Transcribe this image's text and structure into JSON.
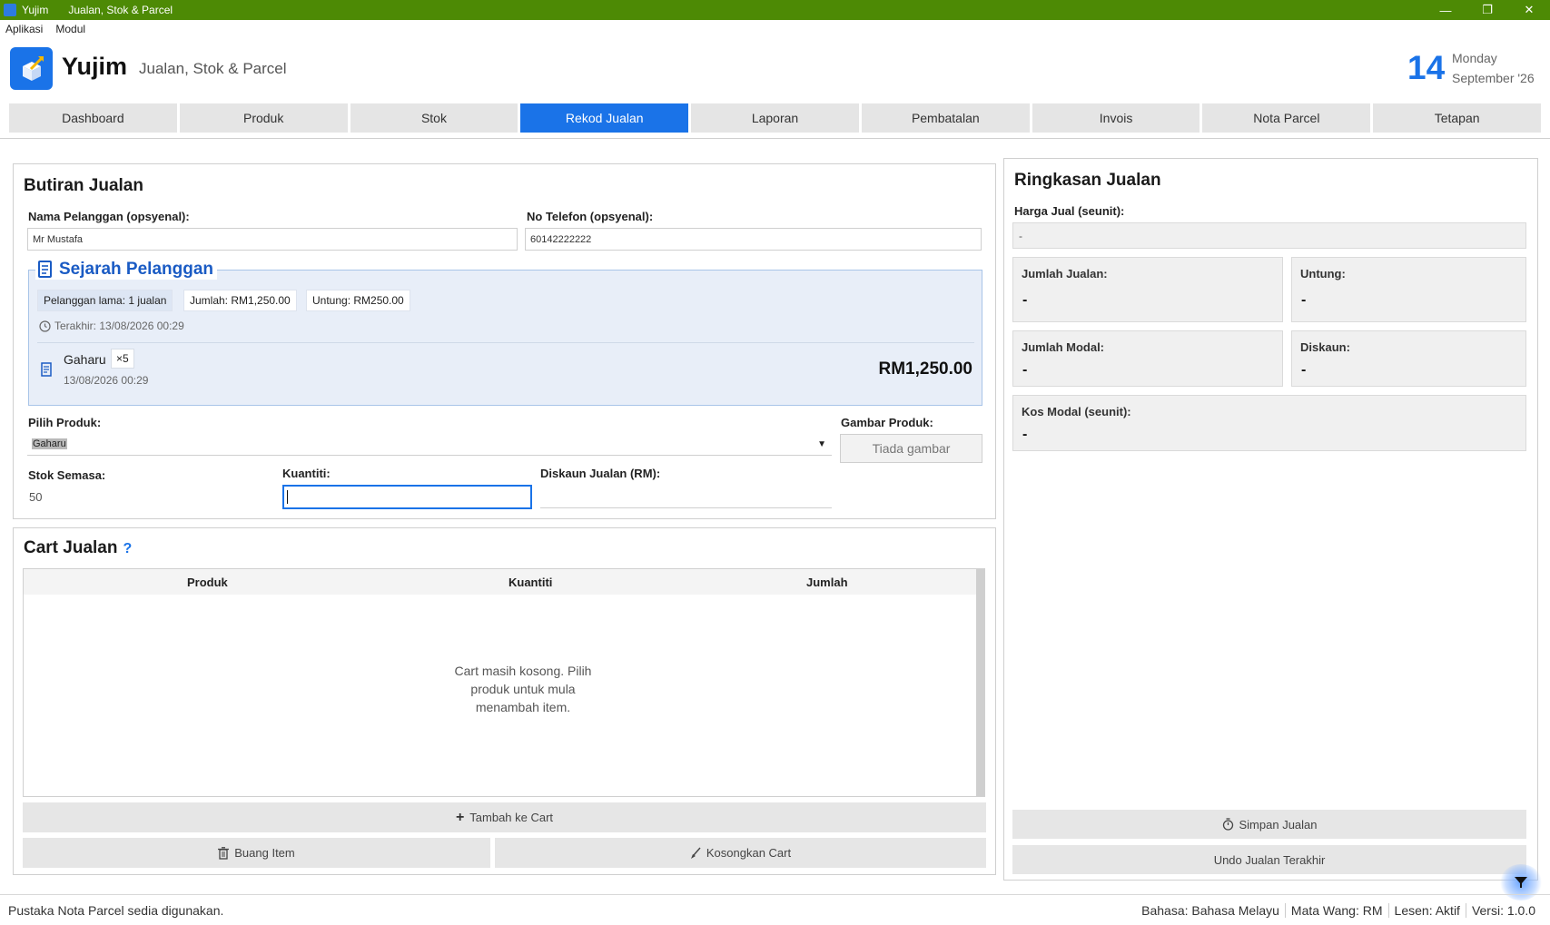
{
  "window": {
    "app_name": "Yujim",
    "title": "Jualan, Stok & Parcel",
    "minimize": "—",
    "restore": "❐",
    "close": "✕"
  },
  "menu": [
    "Aplikasi",
    "Modul"
  ],
  "header": {
    "app_name": "Yujim",
    "subtitle": "Jualan, Stok & Parcel",
    "day": "14",
    "weekday": "Monday",
    "month_year": "September '26"
  },
  "tabs": [
    "Dashboard",
    "Produk",
    "Stok",
    "Rekod Jualan",
    "Laporan",
    "Pembatalan",
    "Invois",
    "Nota Parcel",
    "Tetapan"
  ],
  "active_tab": "Rekod Jualan",
  "butiran": {
    "title": "Butiran Jualan",
    "name_label": "Nama Pelanggan (opsyenal):",
    "name_value": "Mr Mustafa",
    "phone_label": "No Telefon (opsyenal):",
    "phone_value": "60142222222",
    "history": {
      "title": "Sejarah Pelanggan",
      "chip_regular": "Pelanggan lama: 1 jualan",
      "chip_total": "Jumlah: RM1,250.00",
      "chip_profit": "Untung: RM250.00",
      "last": "Terakhir: 13/08/2026 00:29",
      "item_name": "Gaharu",
      "item_qty": "×5",
      "item_date": "13/08/2026 00:29",
      "item_amount": "RM1,250.00"
    },
    "product_label": "Pilih Produk:",
    "product_value": "Gaharu",
    "image_label": "Gambar Produk:",
    "image_placeholder": "Tiada gambar",
    "stock_label": "Stok Semasa:",
    "stock_value": "50",
    "qty_label": "Kuantiti:",
    "qty_value": "",
    "discount_label": "Diskaun Jualan (RM):",
    "discount_value": ""
  },
  "cart": {
    "title": "Cart Jualan",
    "help": "?",
    "columns": [
      "Produk",
      "Kuantiti",
      "Jumlah"
    ],
    "empty_message": "Cart masih kosong. Pilih produk untuk mula menambah item.",
    "add_button": "Tambah ke Cart",
    "remove_button": "Buang Item",
    "clear_button": "Kosongkan Cart"
  },
  "summary": {
    "title": "Ringkasan Jualan",
    "price_label": "Harga Jual (seunit):",
    "price_value": "-",
    "total_sales_label": "Jumlah Jualan:",
    "total_sales_value": "-",
    "profit_label": "Untung:",
    "profit_value": "-",
    "total_cost_label": "Jumlah Modal:",
    "total_cost_value": "-",
    "discount_label": "Diskaun:",
    "discount_value": "-",
    "unit_cost_label": "Kos Modal (seunit):",
    "unit_cost_value": "-",
    "save_button": "Simpan Jualan",
    "undo_button": "Undo Jualan Terakhir"
  },
  "status": {
    "message": "Pustaka Nota Parcel sedia digunakan.",
    "language_label": "Bahasa:",
    "language": "Bahasa Melayu",
    "currency_label": "Mata Wang:",
    "currency": "RM",
    "license_label": "Lesen:",
    "license": "Aktif",
    "version_label": "Versi:",
    "version": "1.0.0"
  },
  "colors": {
    "titlebar": "#4d8a05",
    "accent": "#1a73e8"
  }
}
